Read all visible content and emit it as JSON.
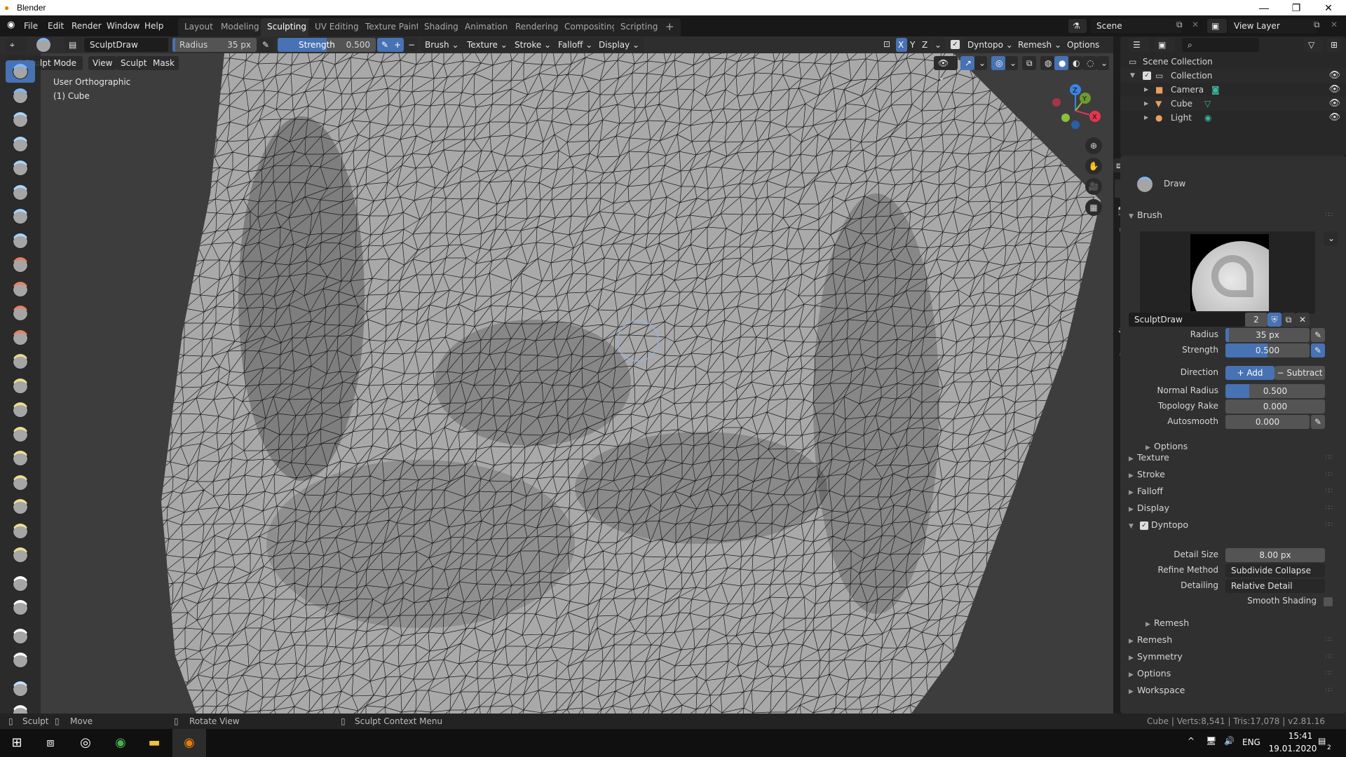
{
  "window": {
    "app_title": "Blender",
    "minimize": "—",
    "maximize": "❐",
    "close": "✕"
  },
  "topbar": {
    "menus": [
      "File",
      "Edit",
      "Render",
      "Window",
      "Help"
    ],
    "workspaces": [
      "Layout",
      "Modeling",
      "Sculpting",
      "UV Editing",
      "Texture Paint",
      "Shading",
      "Animation",
      "Rendering",
      "Compositing",
      "Scripting"
    ],
    "active_workspace": "Sculpting",
    "add_workspace": "+",
    "scene_name": "Scene",
    "view_layer_name": "View Layer"
  },
  "tool_header": {
    "brush_name": "SculptDraw",
    "radius_label": "Radius",
    "radius_value": "35 px",
    "strength_label": "Strength",
    "strength_value": "0.500",
    "strength_fraction": 0.5,
    "add": "+",
    "subtract": "−",
    "dropdowns": [
      "Brush",
      "Texture",
      "Stroke",
      "Falloff",
      "Display"
    ],
    "axis": [
      "X",
      "Y",
      "Z"
    ],
    "active_axis": "X",
    "dyntopo_label": "Dyntopo",
    "dyntopo_checked": true,
    "remesh_label": "Remesh",
    "options_label": "Options"
  },
  "viewport_header": {
    "mode": "Sculpt Mode",
    "menus": [
      "View",
      "Sculpt",
      "Mask"
    ]
  },
  "viewport": {
    "view_name": "User Orthographic",
    "object_label": "(1) Cube",
    "gizmo": {
      "z": "Z",
      "y": "Y",
      "x": "X"
    },
    "nav_buttons": [
      "zoom-icon",
      "pan-hand-icon",
      "camera-view-icon",
      "ortho-grid-icon"
    ]
  },
  "outliner": {
    "root": "Scene Collection",
    "collection": "Collection",
    "objects": [
      {
        "name": "Camera",
        "icon": "camera-icon",
        "data_icon": "camera-data-icon"
      },
      {
        "name": "Cube",
        "icon": "mesh-icon",
        "data_icon": "mesh-data-icon"
      },
      {
        "name": "Light",
        "icon": "light-icon",
        "data_icon": "light-data-icon"
      }
    ]
  },
  "properties": {
    "tool_name": "Draw",
    "brush_panel": "Brush",
    "brush_datablock": "SculptDraw",
    "brush_users": "2",
    "fields": [
      {
        "label": "Radius",
        "value": "35 px",
        "fill": 0.04
      },
      {
        "label": "Strength",
        "value": "0.500",
        "fill": 0.5
      },
      {
        "label": "Normal Radius",
        "value": "0.500",
        "fill": 0.24
      },
      {
        "label": "Topology Rake",
        "value": "0.000",
        "fill": 0
      },
      {
        "label": "Autosmooth",
        "value": "0.000",
        "fill": 0
      }
    ],
    "direction_label": "Direction",
    "direction_add": "Add",
    "direction_subtract": "Subtract",
    "options_sub": "Options",
    "collapsed_panels_a": [
      "Texture",
      "Stroke",
      "Falloff",
      "Display"
    ],
    "dyntopo_panel": "Dyntopo",
    "detail_size_label": "Detail Size",
    "detail_size_value": "8.00 px",
    "refine_method_label": "Refine Method",
    "refine_method_value": "Subdivide Collapse",
    "detailing_label": "Detailing",
    "detailing_value": "Relative Detail",
    "smooth_shading_label": "Smooth Shading",
    "smooth_shading_checked": false,
    "remesh_sub": "Remesh",
    "collapsed_panels_b": [
      "Remesh",
      "Symmetry",
      "Options",
      "Workspace"
    ]
  },
  "statusbar": {
    "left_click": "Sculpt",
    "drag": "Move",
    "middle": "Rotate View",
    "right": "Sculpt Context Menu",
    "stats": "Cube | Verts:8,541 | Tris:17,078 | v2.81.16"
  },
  "taskbar": {
    "language": "ENG",
    "time": "15:41",
    "date": "19.01.2020",
    "notifications": "2"
  },
  "colors": {
    "accent": "#4772b3",
    "active_tool": "#4772b3",
    "x_axis": "#e8344e",
    "y_axis": "#8ac03c",
    "z_axis": "#3a85e0"
  }
}
